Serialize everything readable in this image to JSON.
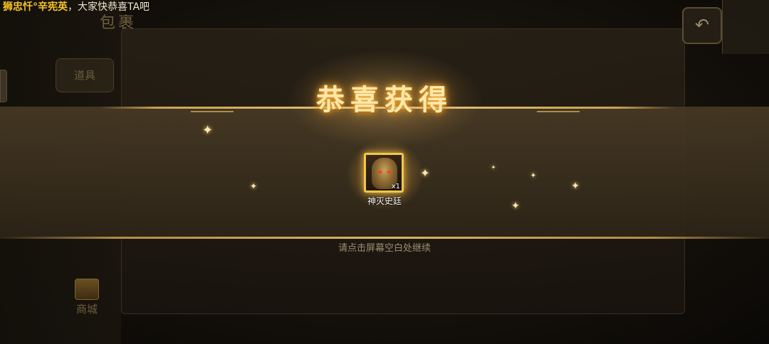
{
  "marquee": {
    "player_name": "狮忠忏°辛宪英",
    "message": "，大家快恭喜TA吧"
  },
  "background": {
    "bag_title": "包裹",
    "side_button_label": "道具",
    "shop_label": "商城",
    "back_icon": "undo-arrow-icon"
  },
  "reward_popup": {
    "title": "恭喜获得",
    "item": {
      "name": "神灭史廷",
      "quantity": "x1",
      "icon": "golden-helmet-hero-portrait",
      "frame_color": "#f3c744"
    },
    "hint": "请点击屏幕空白处继续",
    "sparkles": "decorative-stars"
  },
  "colors": {
    "title_glow": "#ffb640",
    "player_name": "#f5c427",
    "band": "#3a2f1e"
  }
}
